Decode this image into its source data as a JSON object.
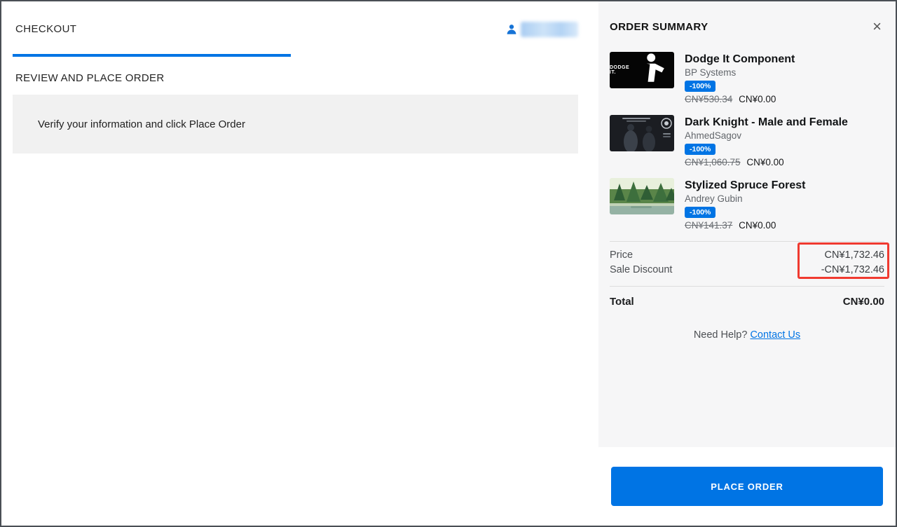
{
  "checkout": {
    "tab_label": "CHECKOUT",
    "section_title": "REVIEW AND PLACE ORDER",
    "verify_message": "Verify your information and click Place Order"
  },
  "order_summary": {
    "title": "ORDER SUMMARY",
    "close_label": "×",
    "items": [
      {
        "title": "Dodge It Component",
        "author": "BP Systems",
        "discount_badge": "-100%",
        "original_price": "CN¥530.34",
        "price": "CN¥0.00",
        "thumb_label": "DODGE IT."
      },
      {
        "title": "Dark Knight - Male and Female",
        "author": "AhmedSagov",
        "discount_badge": "-100%",
        "original_price": "CN¥1,060.75",
        "price": "CN¥0.00"
      },
      {
        "title": "Stylized Spruce Forest",
        "author": "Andrey Gubin",
        "discount_badge": "-100%",
        "original_price": "CN¥141.37",
        "price": "CN¥0.00"
      }
    ],
    "totals": {
      "price_label": "Price",
      "price_value": "CN¥1,732.46",
      "discount_label": "Sale Discount",
      "discount_value": "-CN¥1,732.46",
      "total_label": "Total",
      "total_value": "CN¥0.00"
    },
    "help_text": "Need Help?",
    "contact_link": "Contact Us",
    "place_order_label": "PLACE ORDER"
  },
  "colors": {
    "accent_blue": "#0074e4",
    "annotation_red": "#f03a30"
  }
}
